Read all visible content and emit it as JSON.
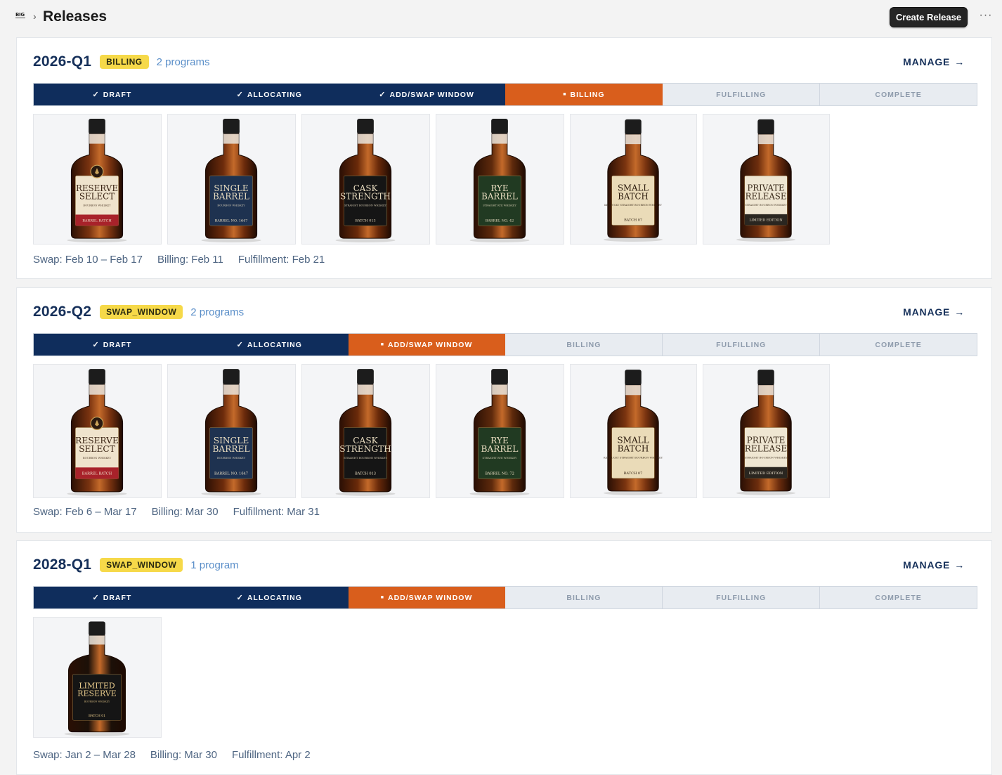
{
  "header": {
    "logo_text": "BIG",
    "breadcrumb_separator": "›",
    "title": "Releases",
    "create_label": "Create Release",
    "more_label": "···"
  },
  "colors": {
    "navy": "#0f2d5c",
    "orange": "#d95e1c",
    "badge_yellow": "#f6d949",
    "link_blue": "#5b8fc9"
  },
  "steps": [
    "DRAFT",
    "ALLOCATING",
    "ADD/SWAP WINDOW",
    "BILLING",
    "FULFILLING",
    "COMPLETE"
  ],
  "releases": [
    {
      "name": "2026-Q1",
      "status": "BILLING",
      "program_count": "2 programs",
      "manage_label": "MANAGE",
      "current_step": 3,
      "swap": "Swap: Feb 10 – Feb 17",
      "billing": "Billing: Feb 11",
      "fulfillment": "Fulfillment: Feb 21",
      "bottles": [
        {
          "line1": "RESERVE",
          "line2": "SELECT",
          "sub": "BOURBON WHISKEY",
          "foot": "BARREL BATCH",
          "label": "#efe3cc",
          "band": "#a8222a",
          "ink": "#3a2414",
          "glass": "#7a3310",
          "emblem": true
        },
        {
          "line1": "SINGLE",
          "line2": "BARREL",
          "sub": "BOURBON WHISKEY",
          "foot": "BARREL NO. 1647",
          "label": "#1e3250",
          "band": "#1e3250",
          "ink": "#e8dcc0",
          "glass": "#6e2c0c"
        },
        {
          "line1": "CASK",
          "line2": "STRENGTH",
          "sub": "STRAIGHT BOURBON WHISKEY",
          "foot": "BATCH 013",
          "label": "#151515",
          "band": "#151515",
          "ink": "#e8dcc0",
          "glass": "#6a2a0a"
        },
        {
          "line1": "RYE",
          "line2": "BARREL",
          "sub": "STRAIGHT RYE WHISKEY",
          "foot": "BARREL NO. 42",
          "label": "#213a22",
          "band": "#213a22",
          "ink": "#e8dcc0",
          "glass": "#5e2a0c"
        },
        {
          "line1": "SMALL",
          "line2": "BATCH",
          "sub": "KENTUCKY STRAIGHT BOURBON WHISKEY",
          "foot": "BATCH 07",
          "label": "#eadbb8",
          "band": "#eadbb8",
          "ink": "#2a1a0c",
          "glass": "#7a3410"
        },
        {
          "line1": "PRIVATE",
          "line2": "RELEASE",
          "sub": "STRAIGHT BOURBON WHISKEY",
          "foot": "LIMITED EDITION",
          "label": "#efe6d2",
          "band": "#2a2620",
          "ink": "#3a2a1a",
          "glass": "#6e2e0e"
        }
      ]
    },
    {
      "name": "2026-Q2",
      "status": "SWAP_WINDOW",
      "program_count": "2 programs",
      "manage_label": "MANAGE",
      "current_step": 2,
      "swap": "Swap: Feb 6 – Mar 17",
      "billing": "Billing: Mar 30",
      "fulfillment": "Fulfillment: Mar 31",
      "bottles": [
        {
          "line1": "RESERVE",
          "line2": "SELECT",
          "sub": "BOURBON WHISKEY",
          "foot": "BARREL BATCH",
          "label": "#efe3cc",
          "band": "#a8222a",
          "ink": "#3a2414",
          "glass": "#7a3310",
          "emblem": true
        },
        {
          "line1": "SINGLE",
          "line2": "BARREL",
          "sub": "BOURBON WHISKEY",
          "foot": "BARREL NO. 1647",
          "label": "#1e3250",
          "band": "#1e3250",
          "ink": "#e8dcc0",
          "glass": "#6e2c0c"
        },
        {
          "line1": "CASK",
          "line2": "STRENGTH",
          "sub": "STRAIGHT BOURBON WHISKEY",
          "foot": "BATCH 013",
          "label": "#151515",
          "band": "#151515",
          "ink": "#e8dcc0",
          "glass": "#6a2a0a"
        },
        {
          "line1": "RYE",
          "line2": "BARREL",
          "sub": "STRAIGHT RYE WHISKEY",
          "foot": "BARREL NO. 72",
          "label": "#213a22",
          "band": "#213a22",
          "ink": "#e8dcc0",
          "glass": "#5e2a0c"
        },
        {
          "line1": "SMALL",
          "line2": "BATCH",
          "sub": "KENTUCKY STRAIGHT BOURBON WHISKEY",
          "foot": "BATCH 07",
          "label": "#eadbb8",
          "band": "#eadbb8",
          "ink": "#2a1a0c",
          "glass": "#7a3410"
        },
        {
          "line1": "PRIVATE",
          "line2": "RELEASE",
          "sub": "STRAIGHT BOURBON WHISKEY",
          "foot": "LIMITED EDITION",
          "label": "#efe6d2",
          "band": "#2a2620",
          "ink": "#3a2a1a",
          "glass": "#6e2e0e"
        }
      ]
    },
    {
      "name": "2028-Q1",
      "status": "SWAP_WINDOW",
      "program_count": "1 program",
      "manage_label": "MANAGE",
      "current_step": 2,
      "swap": "Swap: Jan 2 – Mar 28",
      "billing": "Billing: Mar 30",
      "fulfillment": "Fulfillment: Apr 2",
      "bottles": [
        {
          "line1": "LIMITED",
          "line2": "RESERVE",
          "sub": "BOURBON WHISKEY",
          "foot": "BATCH 01",
          "label": "#151515",
          "band": "#151515",
          "ink": "#e6c98a",
          "glass": "#1c1008",
          "wide": true
        }
      ]
    }
  ]
}
